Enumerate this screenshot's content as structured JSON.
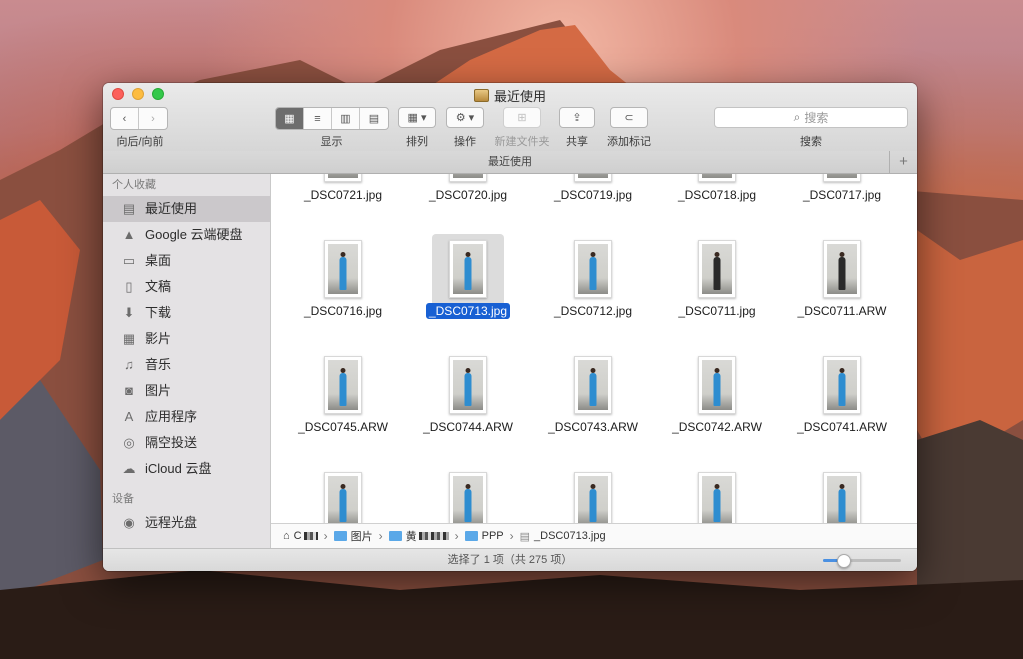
{
  "window": {
    "title": "最近使用"
  },
  "toolbar": {
    "nav_label": "向后/向前",
    "view_label": "显示",
    "arrange_label": "排列",
    "action_label": "操作",
    "new_folder_label": "新建文件夹",
    "share_label": "共享",
    "tag_label": "添加标记",
    "search_placeholder": "搜索",
    "search_label": "搜索"
  },
  "tabbar": {
    "title": "最近使用",
    "plus": "+"
  },
  "sidebar": {
    "favorites_header": "个人收藏",
    "items": [
      {
        "label": "最近使用",
        "icon": "recents-icon",
        "glyph": "▤",
        "selected": true
      },
      {
        "label": "Google 云端硬盘",
        "icon": "google-drive-icon",
        "glyph": "▲",
        "selected": false
      },
      {
        "label": "桌面",
        "icon": "desktop-icon",
        "glyph": "▭",
        "selected": false
      },
      {
        "label": "文稿",
        "icon": "documents-icon",
        "glyph": "▯",
        "selected": false
      },
      {
        "label": "下载",
        "icon": "downloads-icon",
        "glyph": "⬇",
        "selected": false
      },
      {
        "label": "影片",
        "icon": "movies-icon",
        "glyph": "▦",
        "selected": false
      },
      {
        "label": "音乐",
        "icon": "music-icon",
        "glyph": "♫",
        "selected": false
      },
      {
        "label": "图片",
        "icon": "pictures-icon",
        "glyph": "◙",
        "selected": false
      },
      {
        "label": "应用程序",
        "icon": "applications-icon",
        "glyph": "A",
        "selected": false
      },
      {
        "label": "隔空投送",
        "icon": "airdrop-icon",
        "glyph": "◎",
        "selected": false
      },
      {
        "label": "iCloud 云盘",
        "icon": "icloud-icon",
        "glyph": "☁",
        "selected": false
      }
    ],
    "devices_header": "设备",
    "devices": [
      {
        "label": "远程光盘",
        "icon": "remote-disc-icon",
        "glyph": "◉"
      }
    ]
  },
  "files": [
    {
      "name": "_DSC0721.jpg",
      "row": 0,
      "col": 0,
      "figure": "blue"
    },
    {
      "name": "_DSC0720.jpg",
      "row": 0,
      "col": 1,
      "figure": "blue"
    },
    {
      "name": "_DSC0719.jpg",
      "row": 0,
      "col": 2,
      "figure": "blue"
    },
    {
      "name": "_DSC0718.jpg",
      "row": 0,
      "col": 3,
      "figure": "dark"
    },
    {
      "name": "_DSC0717.jpg",
      "row": 0,
      "col": 4,
      "figure": "dark"
    },
    {
      "name": "_DSC0716.jpg",
      "row": 1,
      "col": 0,
      "figure": "blue"
    },
    {
      "name": "_DSC0713.jpg",
      "row": 1,
      "col": 1,
      "figure": "blue",
      "selected": true
    },
    {
      "name": "_DSC0712.jpg",
      "row": 1,
      "col": 2,
      "figure": "blue"
    },
    {
      "name": "_DSC0711.jpg",
      "row": 1,
      "col": 3,
      "figure": "dark"
    },
    {
      "name": "_DSC0711.ARW",
      "row": 1,
      "col": 4,
      "figure": "dark"
    },
    {
      "name": "_DSC0745.ARW",
      "row": 2,
      "col": 0,
      "figure": "blue"
    },
    {
      "name": "_DSC0744.ARW",
      "row": 2,
      "col": 1,
      "figure": "blue"
    },
    {
      "name": "_DSC0743.ARW",
      "row": 2,
      "col": 2,
      "figure": "blue"
    },
    {
      "name": "_DSC0742.ARW",
      "row": 2,
      "col": 3,
      "figure": "blue"
    },
    {
      "name": "_DSC0741.ARW",
      "row": 2,
      "col": 4,
      "figure": "blue"
    },
    {
      "name": "",
      "row": 3,
      "col": 0,
      "figure": "blue"
    },
    {
      "name": "",
      "row": 3,
      "col": 1,
      "figure": "blue"
    },
    {
      "name": "",
      "row": 3,
      "col": 2,
      "figure": "blue"
    },
    {
      "name": "",
      "row": 3,
      "col": 3,
      "figure": "blue"
    },
    {
      "name": "",
      "row": 3,
      "col": 4,
      "figure": "blue"
    }
  ],
  "pathbar": {
    "home": "C",
    "pictures": "图片",
    "user_folder": "黄",
    "ppp": "PPP",
    "file": "_DSC0713.jpg",
    "separator": "›"
  },
  "status": {
    "text": "选择了 1 项（共 275 项）",
    "icon_size_fraction": 0.25
  },
  "colors": {
    "selection": "#1860d3",
    "folder": "#5aa8e8"
  }
}
